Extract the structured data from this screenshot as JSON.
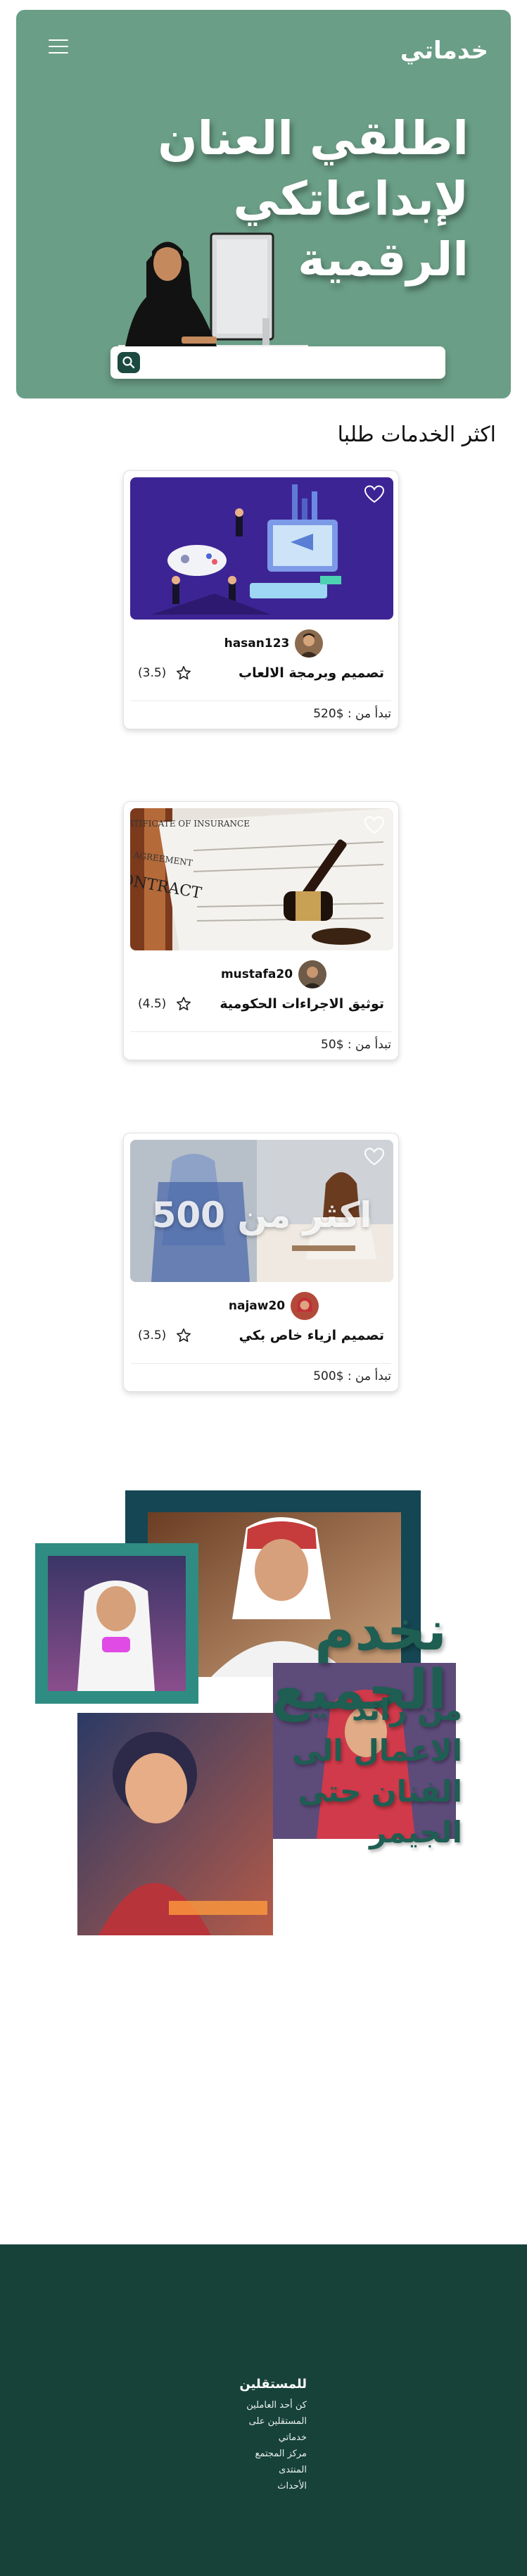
{
  "header": {
    "brand": "خدماتي",
    "hero_title": "اطلقي العنان لإبداعاتكي الرقمية",
    "search_placeholder": ""
  },
  "section": {
    "title": "اكثر الخدمات طلبا"
  },
  "services": [
    {
      "title": "تصميم وبرمجة الالعاب",
      "seller": "hasan123",
      "rating": "(3.5)",
      "price": "تبدأ من : $520"
    },
    {
      "title": "توثيق الاجراءات الحكومية",
      "seller": "mustafa20",
      "rating": "(4.5)",
      "price": "تبدأ من : $50"
    },
    {
      "title": "تصميم ازياء خاص بكي",
      "seller": "najaw20",
      "rating": "(3.5)",
      "price": "تبدأ من : $500"
    }
  ],
  "image_text": {
    "contract_word": "CONTRACT",
    "contract_certificate": "CERTIFICATE OF INSURANCE",
    "contract_service": "SERVICE AGREEMENT",
    "fashion_overlay": "اكثر من 500"
  },
  "collage": {
    "headline": "نخدم الجميع",
    "subline": "من رائد الاعمال الى الفنان حتى الجيمر"
  },
  "footer": {
    "heading": "للمستقلين",
    "links": [
      "كن أحد العاملين",
      "المستقلين على",
      "خدماتي",
      "مركز المجتمع",
      "المنتدى",
      "الأحداث"
    ]
  },
  "colors": {
    "hero_bg": "#6a9e86",
    "accent_dark": "#1c4a40",
    "footer_bg": "#17423a",
    "collage_text": "#1f5e52"
  }
}
